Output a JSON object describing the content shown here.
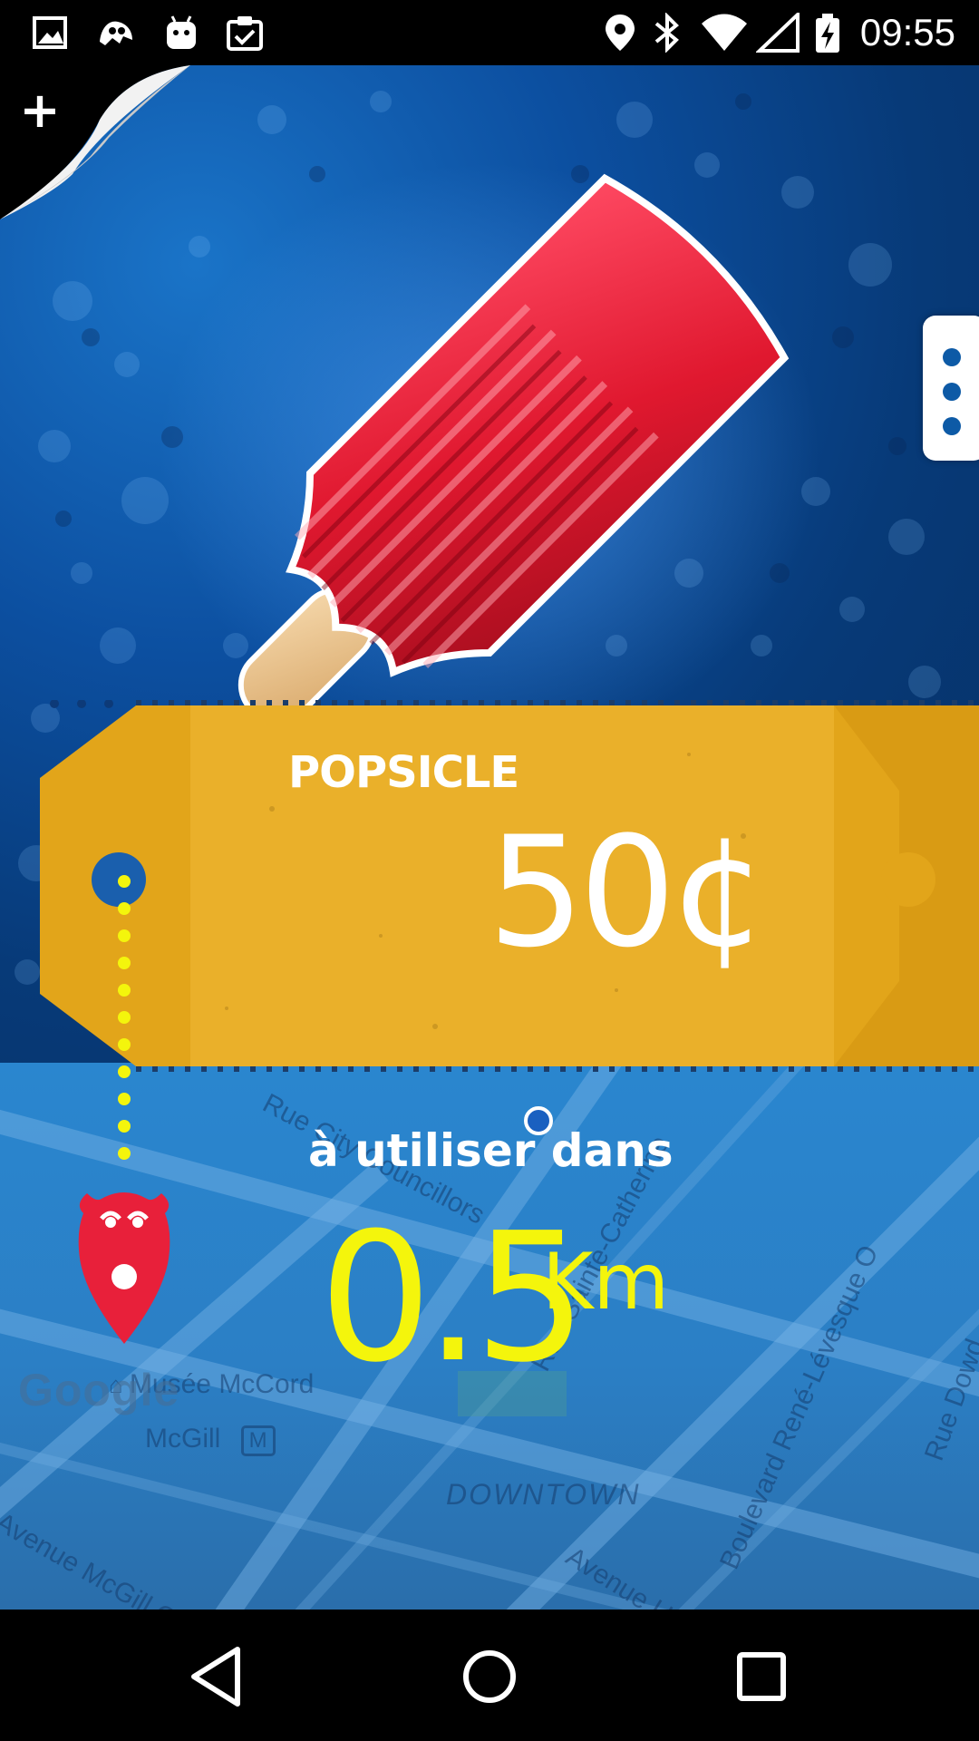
{
  "status_bar": {
    "time": "09:55",
    "left_icons": [
      "image-icon",
      "app-notification-icon",
      "android-icon",
      "clipboard-check-icon"
    ],
    "right_icons": [
      "location-icon",
      "bluetooth-icon",
      "wifi-icon",
      "signal-icon",
      "battery-charging-icon"
    ]
  },
  "deal": {
    "product_name": "POPSICLE",
    "price": "50¢",
    "distance_label": "à utiliser dans",
    "distance_value": "0.5",
    "distance_unit": "Km"
  },
  "map": {
    "labels": {
      "rue_city_councillors": "Rue City Councillors",
      "rue_sainte_catherine": "Rue Sainte-Catherine",
      "musee_mccord": "Musée McCord",
      "mcgill": "McGill",
      "metro_badge": "M",
      "downtown": "DOWNTOWN",
      "avenue_union": "Avenue Union",
      "boulevard_rene_levesque": "Boulevard René-Lévesque O",
      "rue_dowd": "Rue Dowd",
      "avenue_mcgill_college": "Avenue McGill College"
    },
    "attribution": "Google"
  },
  "colors": {
    "ticket": "#e2a51a",
    "price_text": "#ffffff",
    "distance_text": "#f4f50c",
    "pin": "#e8203a",
    "menu_dot": "#0d5aa6"
  },
  "nav_bar": {
    "buttons": [
      "back-icon",
      "home-icon",
      "recents-icon"
    ]
  }
}
